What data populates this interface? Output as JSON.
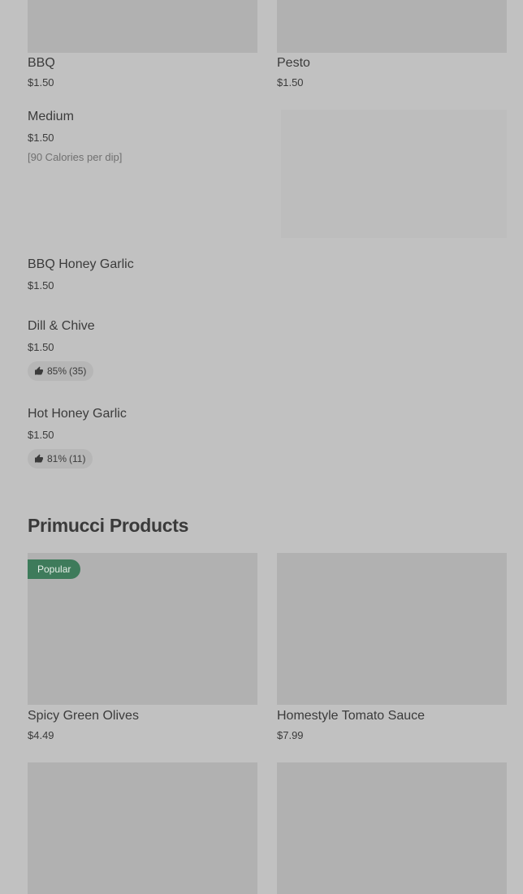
{
  "dips": [
    {
      "name": "BBQ",
      "price": "$1.50"
    },
    {
      "name": "Pesto",
      "price": "$1.50"
    },
    {
      "name": "Medium",
      "price": "$1.50",
      "calories": "[90 Calories per dip]"
    },
    {
      "name": "BBQ Honey Garlic",
      "price": "$1.50"
    },
    {
      "name": "Dill & Chive",
      "price": "$1.50",
      "rating_percent": "85%",
      "rating_count": "(35)"
    },
    {
      "name": "Hot Honey Garlic",
      "price": "$1.50",
      "rating_percent": "81%",
      "rating_count": "(11)"
    }
  ],
  "section": {
    "title": "Primucci Products"
  },
  "products": [
    {
      "name": "Spicy Green Olives",
      "price": "$4.49",
      "badge": "Popular"
    },
    {
      "name": "Homestyle Tomato Sauce",
      "price": "$7.99"
    }
  ],
  "icons": {
    "rating": "thumbs-up-icon"
  },
  "colors": {
    "background": "#c1c1c1",
    "image_placeholder": "#b1b1b1",
    "badge": "#3e7b5b"
  }
}
